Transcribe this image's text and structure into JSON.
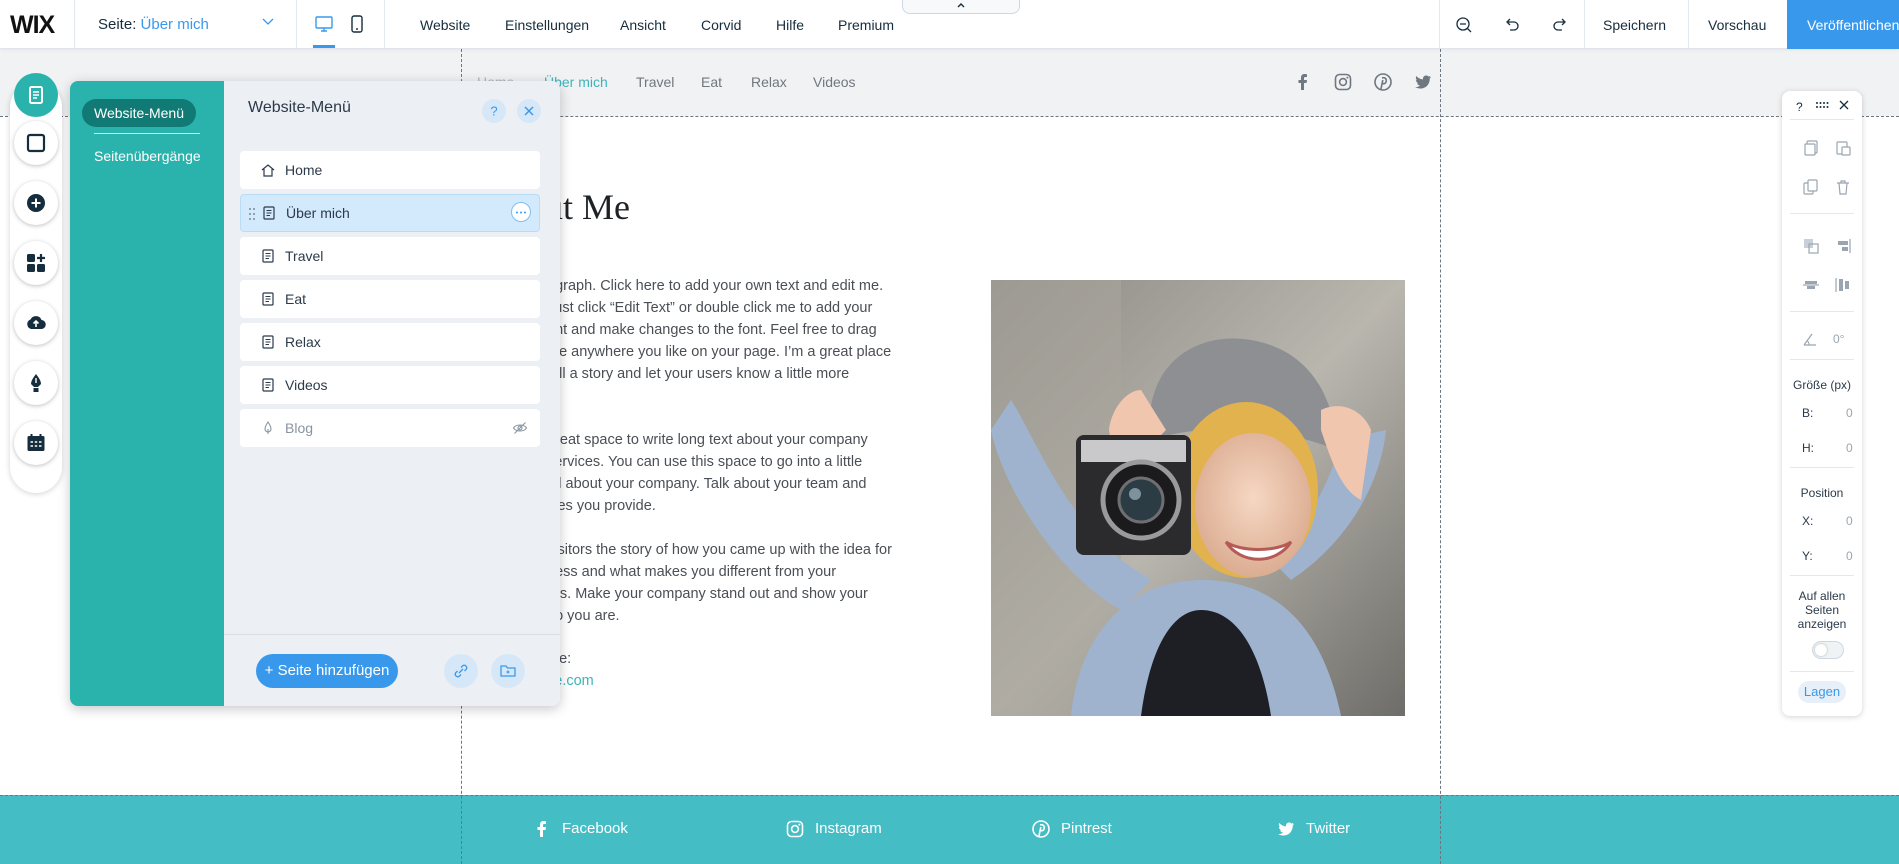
{
  "topbar": {
    "logo": "WIX",
    "page_label": "Seite:",
    "current_page": "Über mich",
    "menu": [
      "Website",
      "Einstellungen",
      "Ansicht",
      "Corvid",
      "Hilfe",
      "Premium"
    ],
    "save": "Speichern",
    "preview": "Vorschau",
    "publish": "Veröffentlichen",
    "accent": "#3899ec"
  },
  "site": {
    "nav": [
      "Home",
      "Über mich",
      "Travel",
      "Eat",
      "Relax",
      "Videos"
    ],
    "active_nav": "Über mich",
    "title": "ut Me",
    "paragraphs": [
      [
        "agraph. Click here to add your own text and edit me.",
        "Just click “Edit Text” or double click me to add your",
        "ent and make changes to the font. Feel free to drag",
        "me anywhere you like on your page. I’m a great place",
        "tell a story and let your users know a little more",
        "u."
      ],
      [
        "great space to write long text about your company",
        "services. You can use this space to go into a little",
        "ail about your company. Talk about your team and",
        "ices you provide."
      ],
      [
        "visitors the story of how you came up with the idea for",
        "ness and what makes you different from your",
        "ors. Make your company stand out and show your",
        "ho you are."
      ]
    ],
    "contact_label": "Me:",
    "contact_link": "ite.com",
    "footer_links": [
      "Facebook",
      "Instagram",
      "Pintrest",
      "Twitter"
    ],
    "footer_color": "#45bdc4",
    "accent": "#3db4bd"
  },
  "panel": {
    "side_tabs": [
      "Website-Menü",
      "Seitenübergänge"
    ],
    "title": "Website-Menü",
    "pages": [
      {
        "label": "Home",
        "icon": "home-icon",
        "state": "normal"
      },
      {
        "label": "Über mich",
        "icon": "page-icon",
        "state": "selected"
      },
      {
        "label": "Travel",
        "icon": "page-icon",
        "state": "normal"
      },
      {
        "label": "Eat",
        "icon": "page-icon",
        "state": "normal"
      },
      {
        "label": "Relax",
        "icon": "page-icon",
        "state": "normal"
      },
      {
        "label": "Videos",
        "icon": "page-icon",
        "state": "normal"
      },
      {
        "label": "Blog",
        "icon": "blog-icon",
        "state": "hidden"
      }
    ],
    "add_page": "+ Seite hinzufügen",
    "side_color": "#2ab3ad"
  },
  "rail": {
    "icons": [
      "pages-icon",
      "background-icon",
      "add-icon",
      "app-market-icon",
      "upload-icon",
      "blog-pen-icon",
      "bookings-icon"
    ]
  },
  "inspector": {
    "help": "?",
    "rotation": "0°",
    "size_title": "Größe (px)",
    "width_key": "B:",
    "width_val": "0",
    "height_key": "H:",
    "height_val": "0",
    "position_title": "Position",
    "x_key": "X:",
    "x_val": "0",
    "y_key": "Y:",
    "y_val": "0",
    "show_all_pages": [
      "Auf allen",
      "Seiten",
      "anzeigen"
    ],
    "layers": "Lagen"
  }
}
